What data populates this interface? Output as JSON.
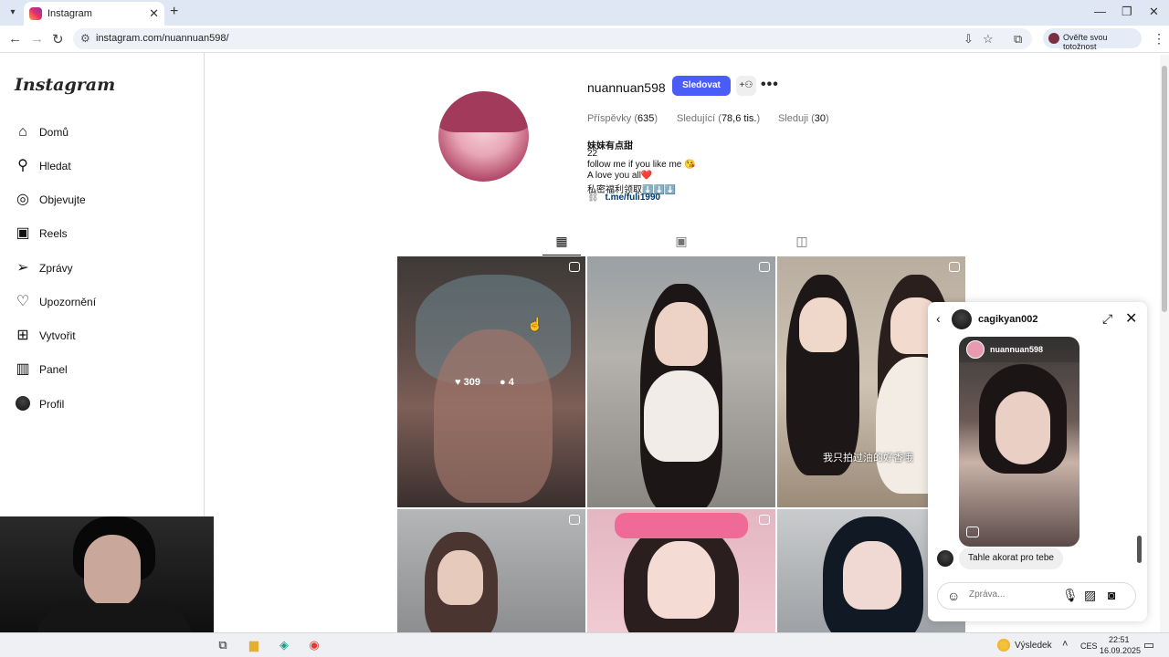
{
  "browser": {
    "tab_title": "Instagram",
    "tab_close": "✕",
    "new_tab": "+",
    "url": "instagram.com/nuannuan598/",
    "verify_label": "Ověřte svou totožnost"
  },
  "sidebar": {
    "logo": "Instagram",
    "items": [
      {
        "label": "Domů",
        "icon": "⌂"
      },
      {
        "label": "Hledat",
        "icon": "⚲"
      },
      {
        "label": "Objevujte",
        "icon": "◎"
      },
      {
        "label": "Reels",
        "icon": "▣"
      },
      {
        "label": "Zprávy",
        "icon": "➢"
      },
      {
        "label": "Upozornění",
        "icon": "♡"
      },
      {
        "label": "Vytvořit",
        "icon": "⊞"
      },
      {
        "label": "Panel",
        "icon": "▥"
      },
      {
        "label": "Profil",
        "icon": ""
      }
    ]
  },
  "profile": {
    "username": "nuannuan598",
    "follow_label": "Sledovat",
    "stats": {
      "posts_label": "Příspěvky",
      "posts_value": "635",
      "followers_label": "Sledující",
      "followers_value": "78,6 tis.",
      "following_label": "Sleduji",
      "following_value": "30"
    },
    "bio": {
      "name": "妹妹有点甜",
      "line1": "22",
      "line2": "follow me if you like me 😘",
      "line3": "A love you all❤️",
      "line4": "私密福利领取⬇️⬇️⬇️",
      "link": "t.me/fuli1990"
    }
  },
  "grid": {
    "hover_likes": "309",
    "hover_comments": "4",
    "tile_overlay_text": "我只拍过油的好香哦"
  },
  "chat": {
    "contact_name": "cagikyan002",
    "shared_post_user": "nuannuan598",
    "message": "Tahle akorat pro tebe",
    "input_placeholder": "Zpráva..."
  },
  "taskbar": {
    "weather_label": "Výsledek",
    "language": "CES",
    "time": "22:51",
    "date": "16.09.2025"
  },
  "colors": {
    "accent": "#4a5df9",
    "link": "#00376b"
  }
}
